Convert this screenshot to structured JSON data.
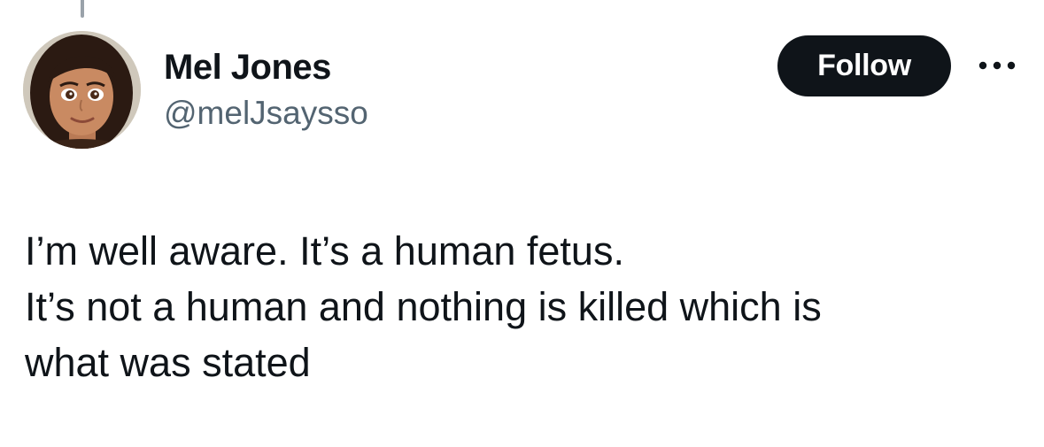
{
  "author": {
    "display_name": "Mel Jones",
    "handle": "@melJsaysso",
    "avatar_icon": "cartoon-girl-avatar"
  },
  "actions": {
    "follow_label": "Follow",
    "more_icon": "more-horizontal-icon"
  },
  "tweet": {
    "lines": [
      "I’m well aware. It’s a human fetus.",
      "It’s not a human and nothing is killed which is",
      "what was stated"
    ]
  },
  "colors": {
    "text_primary": "#0f1419",
    "text_secondary": "#536471",
    "follow_bg": "#0f1419",
    "follow_text": "#ffffff",
    "thread_line": "#9aa2aa"
  }
}
